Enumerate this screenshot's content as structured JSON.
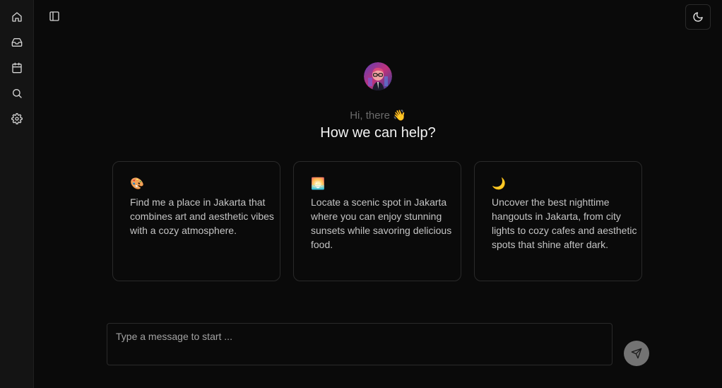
{
  "sidebar": {
    "items": [
      {
        "icon": "home-icon"
      },
      {
        "icon": "inbox-icon"
      },
      {
        "icon": "calendar-icon"
      },
      {
        "icon": "search-icon"
      },
      {
        "icon": "gear-icon"
      }
    ]
  },
  "header": {
    "panel_toggle_icon": "sidebar-panel-icon",
    "theme_toggle_icon": "moon-icon"
  },
  "hero": {
    "greeting": "Hi, there 👋",
    "headline": "How we can help?"
  },
  "suggestions": [
    {
      "emoji": "🎨",
      "text": "Find me a place in Jakarta that combines art and aesthetic vibes with a cozy atmosphere."
    },
    {
      "emoji": "🌅",
      "text": "Locate a scenic spot in Jakarta where you can enjoy stunning sunsets while savoring delicious food."
    },
    {
      "emoji": "🌙",
      "text": "Uncover the best nighttime hangouts in Jakarta, from city lights to cozy cafes and aesthetic spots that shine after dark."
    }
  ],
  "composer": {
    "placeholder": "Type a message to start ...",
    "value": "",
    "send_icon": "send-icon"
  },
  "colors": {
    "background": "#0a0a0a",
    "sidebar": "#141414",
    "border": "#2a2a2a",
    "send_button": "#737373"
  }
}
